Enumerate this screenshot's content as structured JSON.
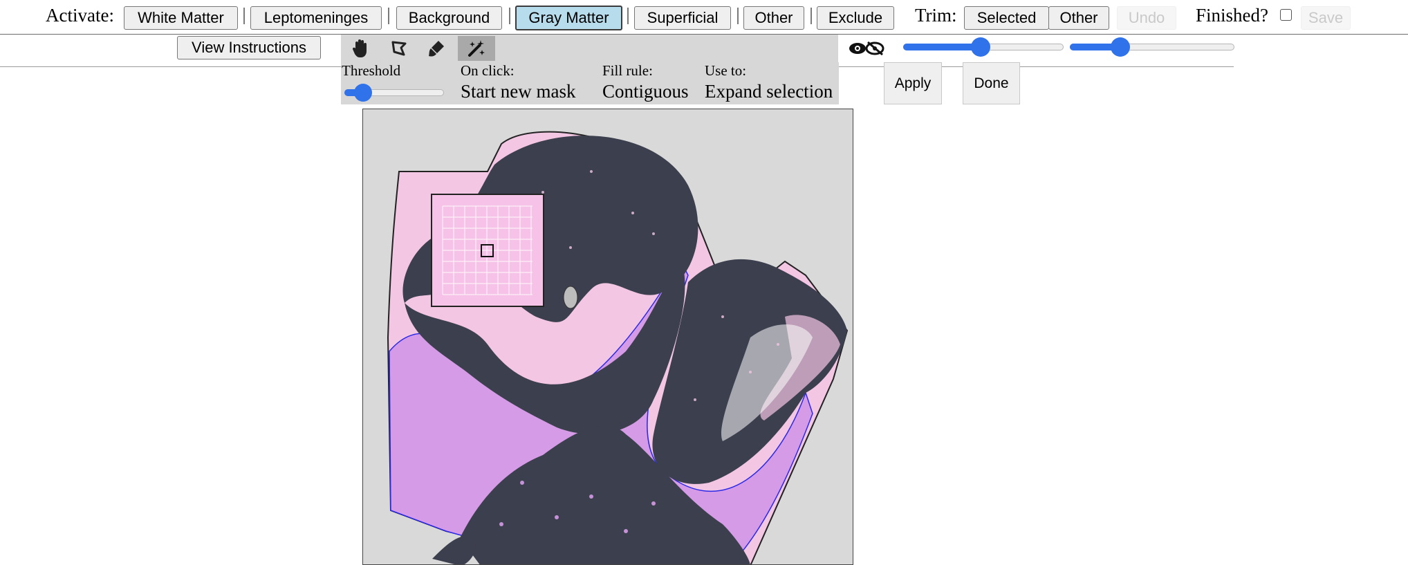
{
  "toolbar": {
    "activate_label": "Activate:",
    "buttons": [
      {
        "label": "White Matter"
      },
      {
        "label": "Leptomeninges"
      },
      {
        "label": "Background"
      },
      {
        "label": "Gray Matter"
      },
      {
        "label": "Superficial"
      },
      {
        "label": "Other"
      },
      {
        "label": "Exclude"
      }
    ],
    "trim_label": "Trim:",
    "trim_selected": "Selected",
    "trim_other": "Other",
    "undo": "Undo",
    "finished_label": "Finished?",
    "save": "Save"
  },
  "second_row": {
    "view_instructions": "View Instructions"
  },
  "tools": [
    {
      "icon": "hand-icon"
    },
    {
      "icon": "lasso-icon"
    },
    {
      "icon": "brush-icon"
    },
    {
      "icon": "magic-wand-icon"
    }
  ],
  "options": {
    "threshold_label": "Threshold",
    "threshold_value": 0.12,
    "on_click_label": "On click:",
    "on_click_value": "Start new mask",
    "fill_rule_label": "Fill rule:",
    "fill_rule_value": "Contiguous",
    "use_to_label": "Use to:",
    "use_to_value": "Expand selection",
    "apply": "Apply",
    "done": "Done"
  },
  "visibility_icon": "eye-toggle-icon",
  "opacity_sliders": [
    {
      "value": 0.48
    },
    {
      "value": 0.28
    }
  ],
  "colors": {
    "active_button": "#b7dcec",
    "slider_blue": "#2f72ea",
    "gray_matter": "#3c3f4e",
    "white_matter_fill": "#d69be6",
    "tissue_pink": "#f3c6e4",
    "canvas_bg": "#d9d9d9"
  }
}
